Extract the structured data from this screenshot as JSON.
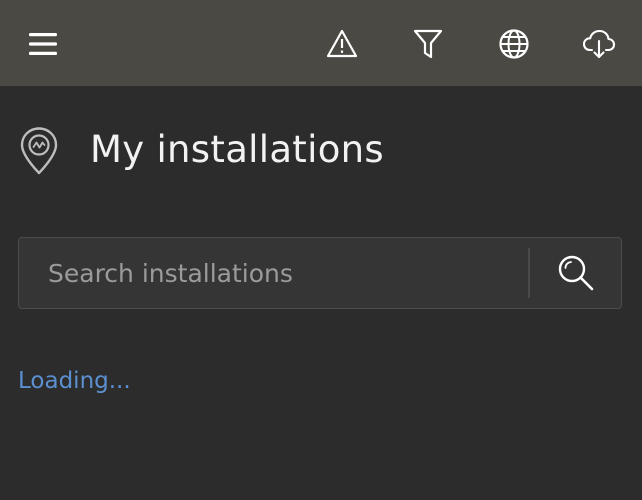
{
  "topbar": {
    "icons": [
      "menu-icon",
      "warning-icon",
      "filter-icon",
      "globe-icon",
      "cloud-download-icon"
    ]
  },
  "header": {
    "title": "My installations",
    "icon": "location-pin-icon"
  },
  "search": {
    "placeholder": "Search installations",
    "value": ""
  },
  "status": {
    "text": "Loading..."
  },
  "colors": {
    "background": "#2c2c2c",
    "topbar": "#4a4944",
    "link": "#5b8fd0"
  }
}
